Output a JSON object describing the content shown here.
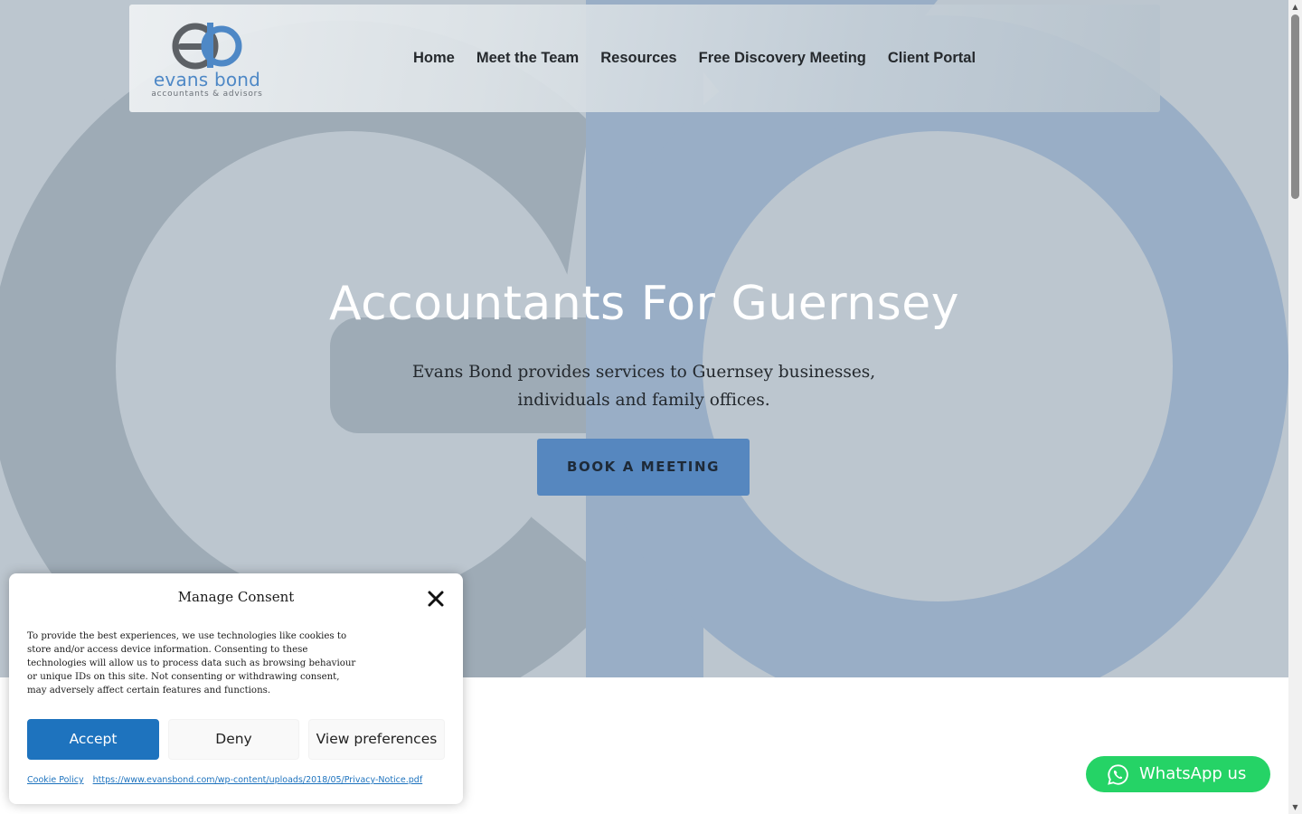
{
  "logo": {
    "name": "evans bond",
    "tagline": "accountants & advisors"
  },
  "nav": {
    "items": [
      {
        "label": "Home"
      },
      {
        "label": "Meet the Team"
      },
      {
        "label": "Resources"
      },
      {
        "label": "Free Discovery Meeting"
      },
      {
        "label": "Client Portal"
      }
    ]
  },
  "hero": {
    "title": "Accountants For Guernsey",
    "subtitle": "Evans Bond provides services to Guernsey businesses, individuals and family offices.",
    "cta_label": "BOOK A MEETING"
  },
  "consent": {
    "title": "Manage Consent",
    "close_icon": "close-icon",
    "text": "To provide the best experiences, we use technologies like cookies to store and/or access device information. Consenting to these technologies will allow us to process data such as browsing behaviour or unique IDs on this site. Not consenting or withdrawing consent, may adversely affect certain features and functions.",
    "accept_label": "Accept",
    "deny_label": "Deny",
    "preferences_label": "View preferences",
    "cookie_policy_label": "Cookie Policy",
    "privacy_link_label": "https://www.evansbond.com/wp-content/uploads/2018/05/Privacy-Notice.pdf"
  },
  "whatsapp": {
    "label": "WhatsApp us",
    "icon": "whatsapp-icon"
  },
  "colors": {
    "brand_blue": "#5687bf",
    "accept_blue": "#1e73be",
    "whatsapp_green": "#25d366",
    "hero_bg": "#bcc6cf"
  }
}
